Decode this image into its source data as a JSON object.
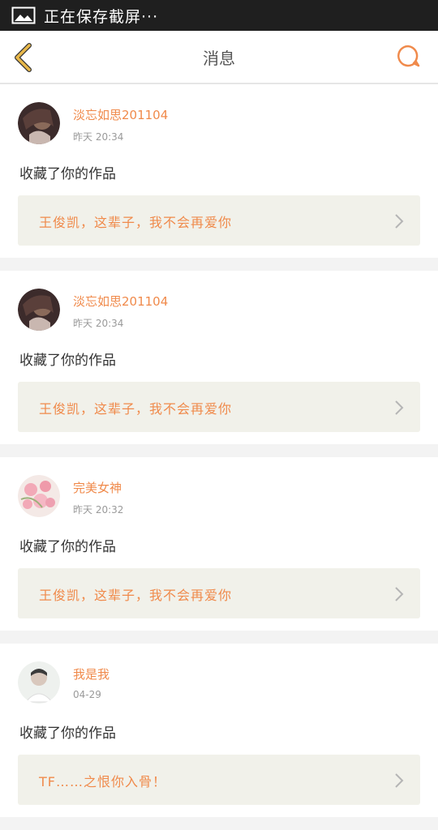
{
  "status_bar": {
    "text": "正在保存截屏···"
  },
  "header": {
    "title": "消息"
  },
  "messages": [
    {
      "user": "淡忘如思201104",
      "time": "昨天 20:34",
      "action": "收藏了你的作品",
      "work_title": "王俊凯，这辈子，我不会再爱你"
    },
    {
      "user": "淡忘如思201104",
      "time": "昨天 20:34",
      "action": "收藏了你的作品",
      "work_title": "王俊凯，这辈子，我不会再爱你"
    },
    {
      "user": "完美女神",
      "time": "昨天 20:32",
      "action": "收藏了你的作品",
      "work_title": "王俊凯，这辈子，我不会再爱你"
    },
    {
      "user": "我是我",
      "time": "04-29",
      "action": "收藏了你的作品",
      "work_title": "TF……之恨你入骨！"
    }
  ],
  "colors": {
    "accent": "#f08a4b",
    "back_arrow": "#e8b84a"
  }
}
